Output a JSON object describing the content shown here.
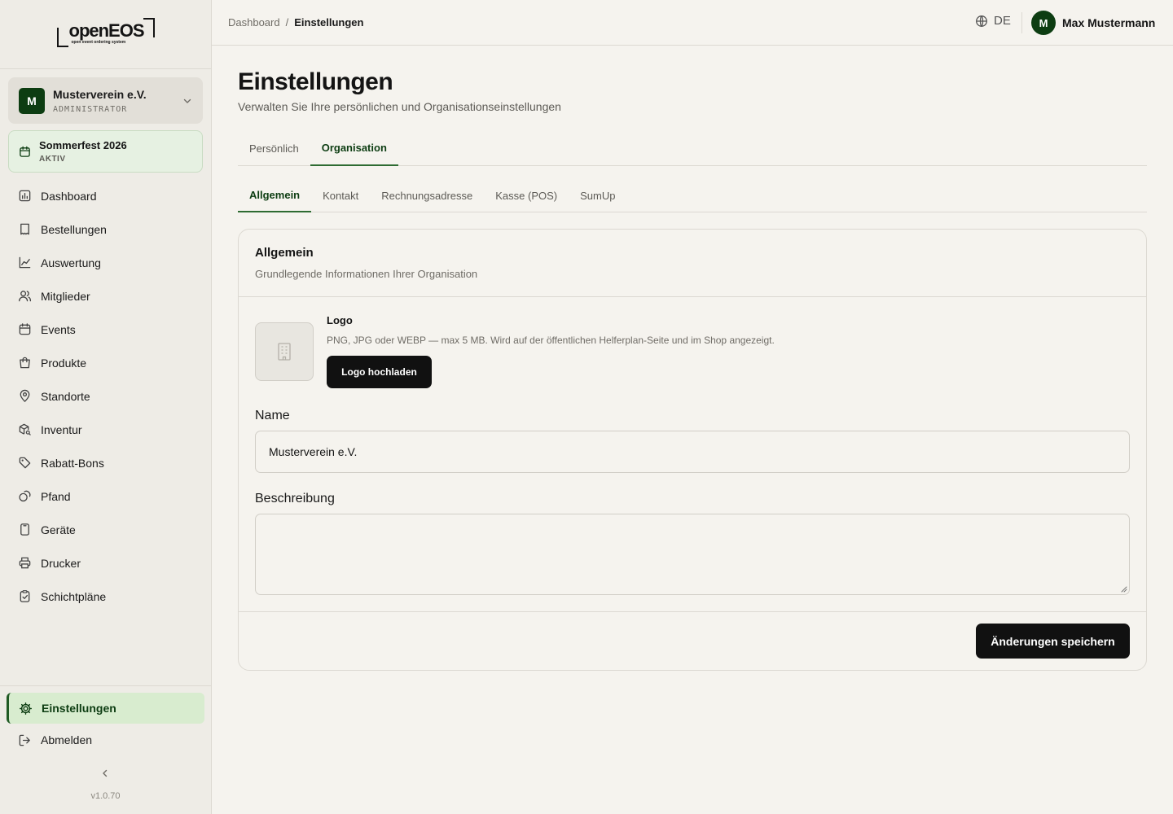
{
  "app": {
    "logo_text": "openEOS",
    "logo_tagline": "open event ordering system",
    "version": "v1.0.70"
  },
  "org": {
    "initial": "M",
    "name": "Musterverein e.V.",
    "role": "ADMINISTRATOR"
  },
  "event": {
    "name": "Sommerfest 2026",
    "status": "AKTIV"
  },
  "sidebar": {
    "items": [
      {
        "label": "Dashboard",
        "icon": "chart-icon"
      },
      {
        "label": "Bestellungen",
        "icon": "receipt-icon"
      },
      {
        "label": "Auswertung",
        "icon": "trend-icon"
      },
      {
        "label": "Mitglieder",
        "icon": "users-icon"
      },
      {
        "label": "Events",
        "icon": "calendar-icon"
      },
      {
        "label": "Produkte",
        "icon": "bag-icon"
      },
      {
        "label": "Standorte",
        "icon": "map-pin-icon"
      },
      {
        "label": "Inventur",
        "icon": "package-search-icon"
      },
      {
        "label": "Rabatt-Bons",
        "icon": "tag-icon"
      },
      {
        "label": "Pfand",
        "icon": "coins-icon"
      },
      {
        "label": "Geräte",
        "icon": "tablet-icon"
      },
      {
        "label": "Drucker",
        "icon": "printer-icon"
      },
      {
        "label": "Schichtpläne",
        "icon": "clipboard-check-icon"
      }
    ],
    "settings_label": "Einstellungen",
    "logout_label": "Abmelden"
  },
  "header": {
    "breadcrumb": [
      "Dashboard",
      "Einstellungen"
    ],
    "breadcrumb_sep": "/",
    "language": "DE",
    "user_initial": "M",
    "user_name": "Max Mustermann"
  },
  "page": {
    "title": "Einstellungen",
    "subtitle": "Verwalten Sie Ihre persönlichen und Organisationseinstellungen"
  },
  "tabs": [
    {
      "label": "Persönlich",
      "active": false
    },
    {
      "label": "Organisation",
      "active": true
    }
  ],
  "subtabs": [
    {
      "label": "Allgemein",
      "active": true
    },
    {
      "label": "Kontakt",
      "active": false
    },
    {
      "label": "Rechnungsadresse",
      "active": false
    },
    {
      "label": "Kasse (POS)",
      "active": false
    },
    {
      "label": "SumUp",
      "active": false
    }
  ],
  "card": {
    "title": "Allgemein",
    "description": "Grundlegende Informationen Ihrer Organisation",
    "logo_label": "Logo",
    "logo_hint": "PNG, JPG oder WEBP — max 5 MB. Wird auf der öffentlichen Helferplan-Seite und im Shop angezeigt.",
    "upload_label": "Logo hochladen",
    "name_label": "Name",
    "name_value": "Musterverein e.V.",
    "description_label": "Beschreibung",
    "description_value": "",
    "save_label": "Änderungen speichern"
  },
  "colors": {
    "accent": "#0d3d12",
    "active_bg": "#d8eccf",
    "background": "#f5f3ee"
  }
}
